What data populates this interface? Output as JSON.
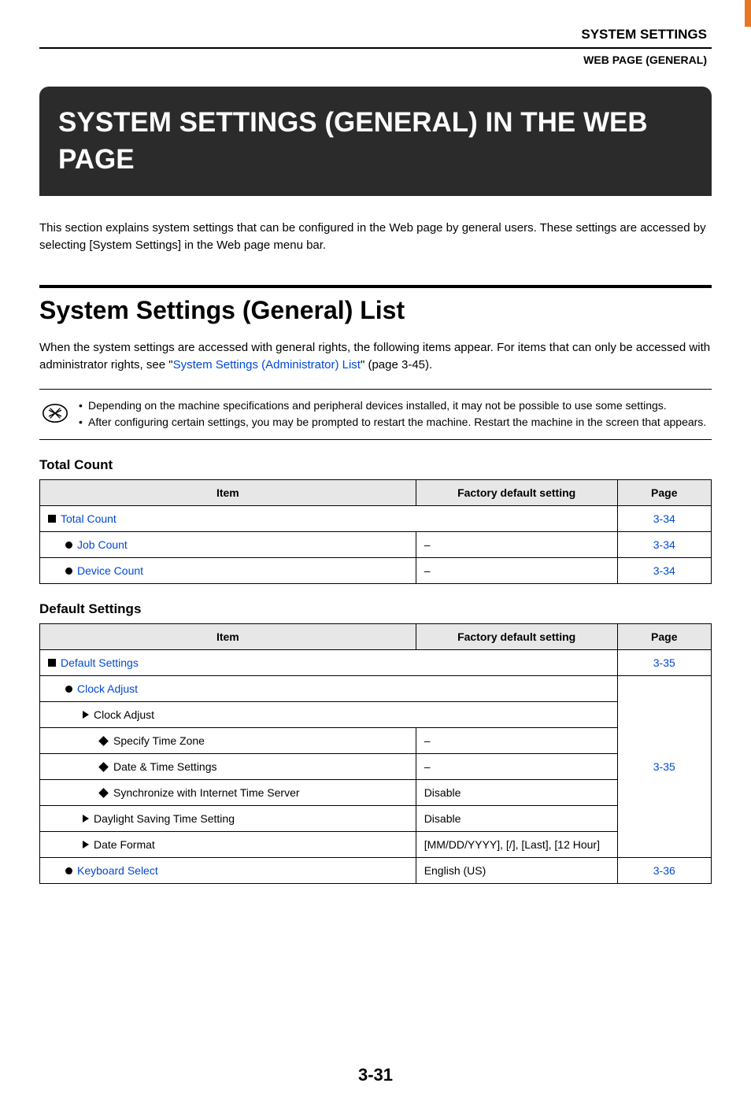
{
  "header": {
    "breadcrumb1": "SYSTEM SETTINGS",
    "breadcrumb2": "WEB PAGE (GENERAL)"
  },
  "title": "SYSTEM SETTINGS (GENERAL) IN THE WEB PAGE",
  "intro": "This section explains system settings that can be configured in the Web page by general users. These settings are accessed by selecting [System Settings] in the Web page menu bar.",
  "section_title": "System Settings (General) List",
  "section_intro_pre": "When the system settings are accessed with general rights, the following items appear. For items that can only be accessed with administrator rights, see \"",
  "section_intro_link": "System Settings (Administrator) List",
  "section_intro_post": "\" (page 3-45).",
  "note_bullets": [
    "Depending on the machine specifications and peripheral devices installed, it may not be possible to use some settings.",
    "After configuring certain settings, you may be prompted to restart the machine. Restart the machine in the screen that appears."
  ],
  "table_headers": {
    "item": "Item",
    "factory": "Factory default setting",
    "page": "Page"
  },
  "table1_title": "Total Count",
  "table1_rows": [
    {
      "marker": "sq",
      "label": "Total Count",
      "link": true,
      "factory": null,
      "span_factory": true,
      "page": "3-34"
    },
    {
      "marker": "dot",
      "label": "Job Count",
      "link": true,
      "factory": "–",
      "span_factory": false,
      "page": "3-34"
    },
    {
      "marker": "dot",
      "label": "Device Count",
      "link": true,
      "factory": "–",
      "span_factory": false,
      "page": "3-34"
    }
  ],
  "table2_title": "Default Settings",
  "table2": {
    "group_page": "3-35",
    "header_row": {
      "marker": "sq",
      "label": "Default Settings",
      "link": true,
      "page": "3-35"
    },
    "clock_adjust": {
      "marker": "dot",
      "label": "Clock Adjust",
      "link": true
    },
    "clock_adjust_sub": {
      "marker": "tri",
      "label": "Clock Adjust",
      "link": false
    },
    "rows_mid": [
      {
        "marker": "dia",
        "label": "Specify Time Zone",
        "factory": "–"
      },
      {
        "marker": "dia",
        "label": "Date & Time Settings",
        "factory": "–"
      },
      {
        "marker": "dia",
        "label": "Synchronize with Internet Time Server",
        "factory": "Disable"
      },
      {
        "marker": "tri",
        "label": "Daylight Saving Time Setting",
        "factory": "Disable"
      },
      {
        "marker": "tri",
        "label": "Date Format",
        "factory": "[MM/DD/YYYY], [/], [Last], [12 Hour]"
      }
    ],
    "keyboard_row": {
      "marker": "dot",
      "label": "Keyboard Select",
      "link": true,
      "factory": "English (US)",
      "page": "3-36"
    }
  },
  "page_number": "3-31"
}
